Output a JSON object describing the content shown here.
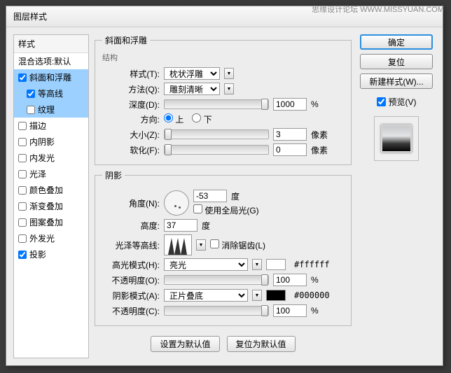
{
  "watermark": "思缘设计论坛  WWW.MISSYUAN.COM",
  "dialog_title": "图层样式",
  "styles_panel": {
    "header": "样式",
    "blend_header": "混合选项:默认",
    "items": [
      {
        "label": "斜面和浮雕",
        "checked": true,
        "selected": true
      },
      {
        "label": "等高线",
        "checked": true,
        "selected": true,
        "sub": true
      },
      {
        "label": "纹理",
        "checked": false,
        "selected": true,
        "sub": true
      },
      {
        "label": "描边",
        "checked": false
      },
      {
        "label": "内阴影",
        "checked": false
      },
      {
        "label": "内发光",
        "checked": false
      },
      {
        "label": "光泽",
        "checked": false
      },
      {
        "label": "颜色叠加",
        "checked": false
      },
      {
        "label": "渐变叠加",
        "checked": false
      },
      {
        "label": "图案叠加",
        "checked": false
      },
      {
        "label": "外发光",
        "checked": false
      },
      {
        "label": "投影",
        "checked": true
      }
    ]
  },
  "bevel": {
    "legend": "斜面和浮雕",
    "structure_label": "结构",
    "style_label": "样式(T):",
    "style_value": "枕状浮雕",
    "technique_label": "方法(Q):",
    "technique_value": "雕刻清晰",
    "depth_label": "深度(D):",
    "depth_value": "1000",
    "depth_unit": "%",
    "direction_label": "方向:",
    "dir_up": "上",
    "dir_down": "下",
    "size_label": "大小(Z):",
    "size_value": "3",
    "size_unit": "像素",
    "soften_label": "软化(F):",
    "soften_value": "0",
    "soften_unit": "像素"
  },
  "shading": {
    "legend": "阴影",
    "angle_label": "角度(N):",
    "angle_value": "-53",
    "angle_unit": "度",
    "global_light": "使用全局光(G)",
    "altitude_label": "高度:",
    "altitude_value": "37",
    "altitude_unit": "度",
    "gloss_label": "光泽等高线:",
    "antialias": "消除锯齿(L)",
    "highlight_mode_label": "高光模式(H):",
    "highlight_mode_value": "亮光",
    "highlight_opacity_label": "不透明度(O):",
    "highlight_opacity_value": "100",
    "highlight_color": "#ffffff",
    "shadow_mode_label": "阴影模式(A):",
    "shadow_mode_value": "正片叠底",
    "shadow_opacity_label": "不透明度(C):",
    "shadow_opacity_value": "100",
    "shadow_color": "#000000",
    "opacity_unit": "%"
  },
  "defaults": {
    "set_default": "设置为默认值",
    "reset_default": "复位为默认值"
  },
  "right": {
    "ok": "确定",
    "cancel": "复位",
    "new_style": "新建样式(W)...",
    "preview": "预览(V)"
  }
}
